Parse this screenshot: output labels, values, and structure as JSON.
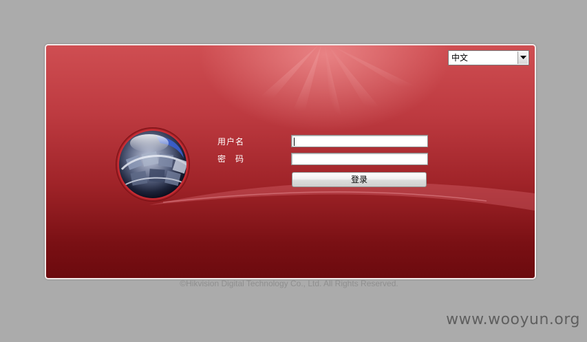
{
  "language": {
    "selected": "中文"
  },
  "form": {
    "username_label": "用户名",
    "password_label": "密　码",
    "username_value": "",
    "password_value": "",
    "login_label": "登录"
  },
  "footer": {
    "copyright": "©Hikvision Digital Technology Co., Ltd. All Rights Reserved."
  },
  "watermark": {
    "text": "www.wooyun.org"
  },
  "colors": {
    "page_background": "#ababab",
    "panel_red": "#bd3a40",
    "panel_dark_red": "#6c0a0e",
    "panel_border": "#f4eaea"
  }
}
